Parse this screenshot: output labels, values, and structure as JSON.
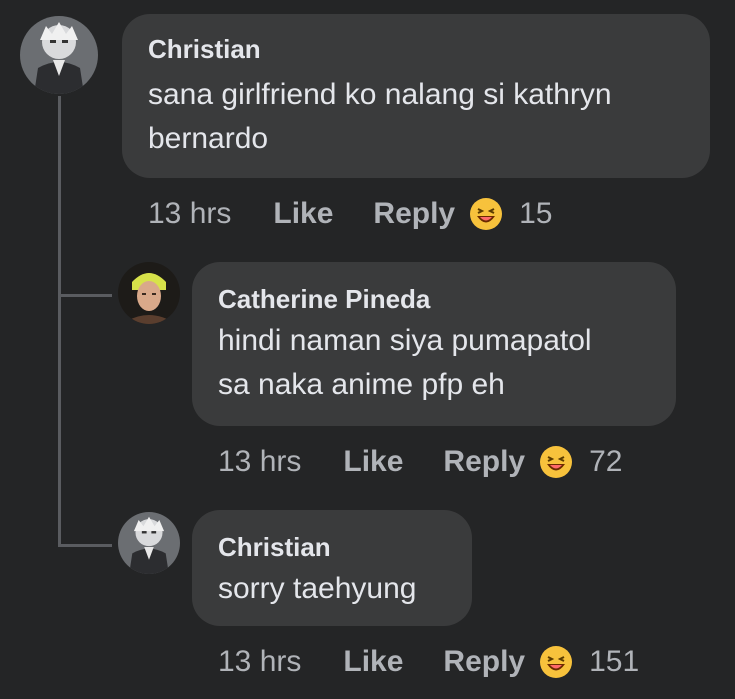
{
  "comments": [
    {
      "author": "Christian",
      "lines": [
        "sana girlfriend ko nalang si kathryn",
        "bernardo"
      ],
      "time": "13 hrs",
      "like_label": "Like",
      "reply_label": "Reply",
      "reaction_icon": "laughing-emoji-icon",
      "reaction_count": "15"
    },
    {
      "author": "Catherine Pineda",
      "lines": [
        "hindi naman siya pumapatol",
        "sa naka anime pfp eh"
      ],
      "time": "13 hrs",
      "like_label": "Like",
      "reply_label": "Reply",
      "reaction_icon": "laughing-emoji-icon",
      "reaction_count": "72"
    },
    {
      "author": "Christian",
      "lines": [
        "sorry taehyung"
      ],
      "time": "13 hrs",
      "like_label": "Like",
      "reply_label": "Reply",
      "reaction_icon": "laughing-emoji-icon",
      "reaction_count": "151"
    }
  ],
  "colors": {
    "background": "#242526",
    "bubble": "#3a3b3c",
    "text": "#e4e6eb",
    "meta": "#b0b3b8",
    "emoji_face": "#f7c23c"
  }
}
